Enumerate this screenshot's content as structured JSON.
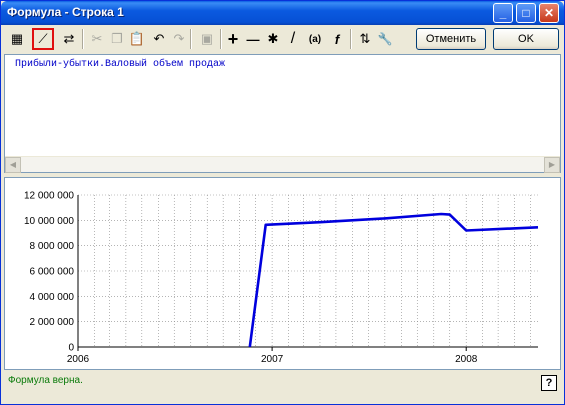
{
  "window": {
    "title": "Формула - Строка 1",
    "controls": {
      "minimize": "_",
      "maximize": "□",
      "close": "✕"
    }
  },
  "toolbar": {
    "icons": [
      "calculator-icon",
      "chart-icon",
      "convert-icon",
      "cut-icon",
      "copy-icon",
      "paste-icon",
      "undo-icon",
      "redo-icon",
      "insert-icon",
      "plus-icon",
      "minus-icon",
      "multiply-icon",
      "divide-icon",
      "parentheses-icon",
      "function-icon",
      "sort-icon",
      "wrench-icon"
    ],
    "glyphs": {
      "calc": "▦",
      "chart": "⟋",
      "convert": "⇄",
      "cut": "✂",
      "copy": "❐",
      "paste": "📋",
      "undo": "↶",
      "redo": "↷",
      "insert": "▣",
      "plus": "+",
      "minus": "—",
      "multiply": "✱",
      "divide": "/",
      "paren": "(a)",
      "func": "f",
      "sort": "⇅",
      "wrench": "🔧"
    },
    "cancel_label": "Отменить",
    "ok_label": "OK"
  },
  "editor": {
    "formula": "Прибыли-убытки.Валовый объем продаж",
    "scroll_left": "◀",
    "scroll_right": "▶"
  },
  "chart_data": {
    "type": "line",
    "x_ticks": [
      "2006",
      "2007",
      "2008"
    ],
    "y_ticks": [
      "0",
      "2 000 000",
      "4 000 000",
      "6 000 000",
      "8 000 000",
      "10 000 000",
      "12 000 000"
    ],
    "ylim": [
      0,
      12000000
    ],
    "xlim": [
      "2006-01-01",
      "2008-05-15"
    ],
    "grid": true,
    "series": [
      {
        "color": "#0000dd",
        "points": [
          {
            "x": "2006-11-20",
            "y": 0
          },
          {
            "x": "2006-12-20",
            "y": 9650000
          },
          {
            "x": "2007-04-01",
            "y": 9850000
          },
          {
            "x": "2007-08-01",
            "y": 10150000
          },
          {
            "x": "2007-11-15",
            "y": 10500000
          },
          {
            "x": "2007-12-01",
            "y": 10450000
          },
          {
            "x": "2008-01-01",
            "y": 9200000
          },
          {
            "x": "2008-05-15",
            "y": 9450000
          }
        ]
      }
    ]
  },
  "status": {
    "message": "Формула верна.",
    "help": "?"
  }
}
